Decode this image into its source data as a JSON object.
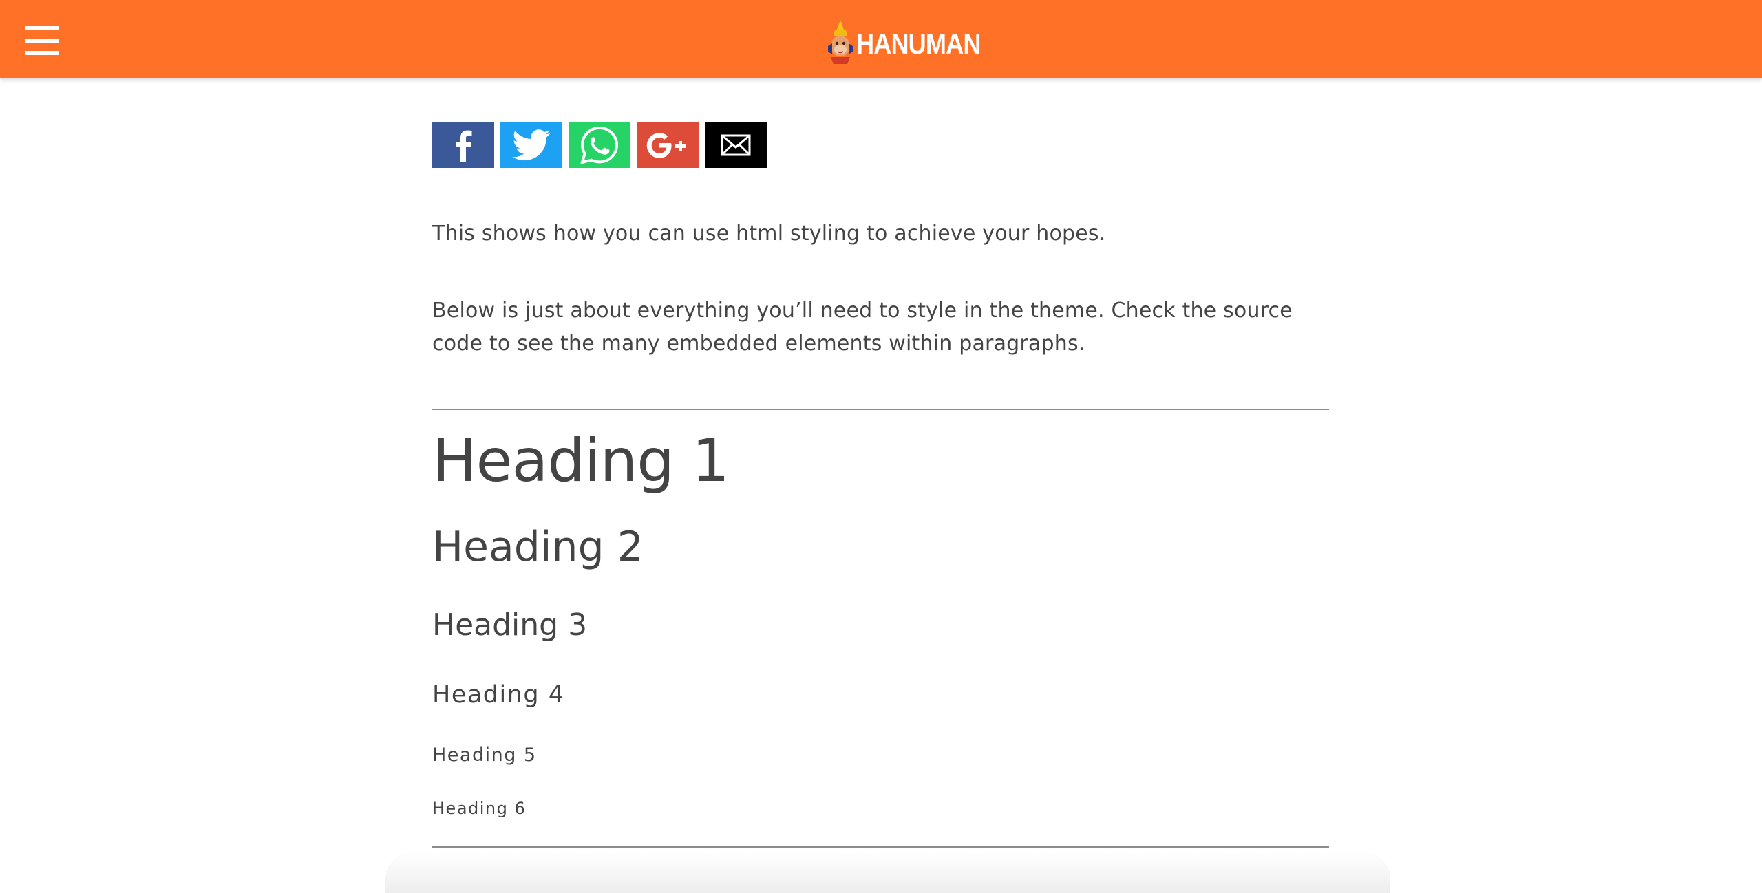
{
  "header": {
    "brand_name": "HANUMAN",
    "background_color": "#ff7126",
    "menu_icon": "hamburger-menu-icon",
    "logo_icon": "hanuman-mascot-icon"
  },
  "share_buttons": [
    {
      "network": "Facebook",
      "icon": "facebook-icon",
      "color": "#3b5998"
    },
    {
      "network": "Twitter",
      "icon": "twitter-icon",
      "color": "#1da1f2"
    },
    {
      "network": "WhatsApp",
      "icon": "whatsapp-icon",
      "color": "#25d366"
    },
    {
      "network": "Google+",
      "icon": "google-plus-icon",
      "color": "#dd4b39"
    },
    {
      "network": "Email",
      "icon": "email-icon",
      "color": "#000000"
    }
  ],
  "content": {
    "intro": "This shows how you can use html styling to achieve your hopes.",
    "description": "Below is just about everything you’ll need to style in the theme. Check the source code to see the many embedded elements within paragraphs.",
    "headings": {
      "h1": "Heading 1",
      "h2": "Heading 2",
      "h3": "Heading 3",
      "h4": "Heading 4",
      "h5": "Heading 5",
      "h6": "Heading 6"
    }
  }
}
